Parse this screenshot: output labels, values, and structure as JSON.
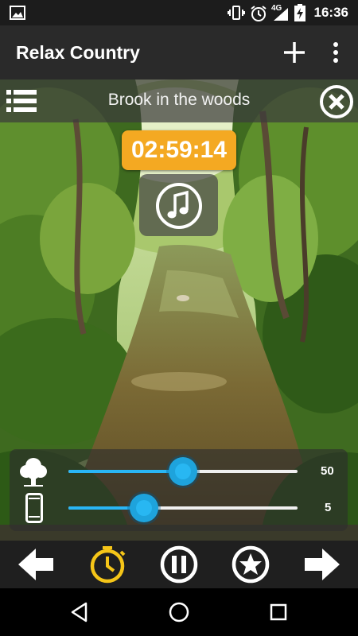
{
  "status_bar": {
    "time": "16:36",
    "network_label": "4G",
    "icons": [
      "image-icon",
      "vibrate-icon",
      "alarm-icon",
      "signal-icon",
      "battery-charging-icon"
    ]
  },
  "app_bar": {
    "title": "Relax Country",
    "icons": [
      "add-icon",
      "more-vert-icon"
    ]
  },
  "sound_strip": {
    "title": "Brook in the woods",
    "icons": [
      "list-menu-icon",
      "close-circle-icon"
    ]
  },
  "timer": {
    "display": "02:59:14"
  },
  "music_tile": {
    "icon": "music-note-icon"
  },
  "mixer": {
    "sliders": [
      {
        "icon": "tree-icon",
        "value": 50,
        "value_label": "50",
        "fraction": 0.5,
        "color": "#29b6f6"
      },
      {
        "icon": "phone-icon",
        "value": 5,
        "value_label": "5",
        "fraction": 0.33,
        "color": "#29b6f6"
      }
    ]
  },
  "controls": {
    "buttons": [
      "previous-arrow-icon",
      "timer-clock-icon",
      "pause-icon",
      "favorite-star-icon",
      "next-arrow-icon"
    ],
    "accent": "#f5c518"
  },
  "nav_bar": {
    "icons": [
      "back-triangle-icon",
      "home-circle-icon",
      "recents-square-icon"
    ]
  },
  "colors": {
    "timer_bg": "#f4a922",
    "slider_accent": "#29b6f6",
    "bar_bg": "#2a2a2a"
  }
}
